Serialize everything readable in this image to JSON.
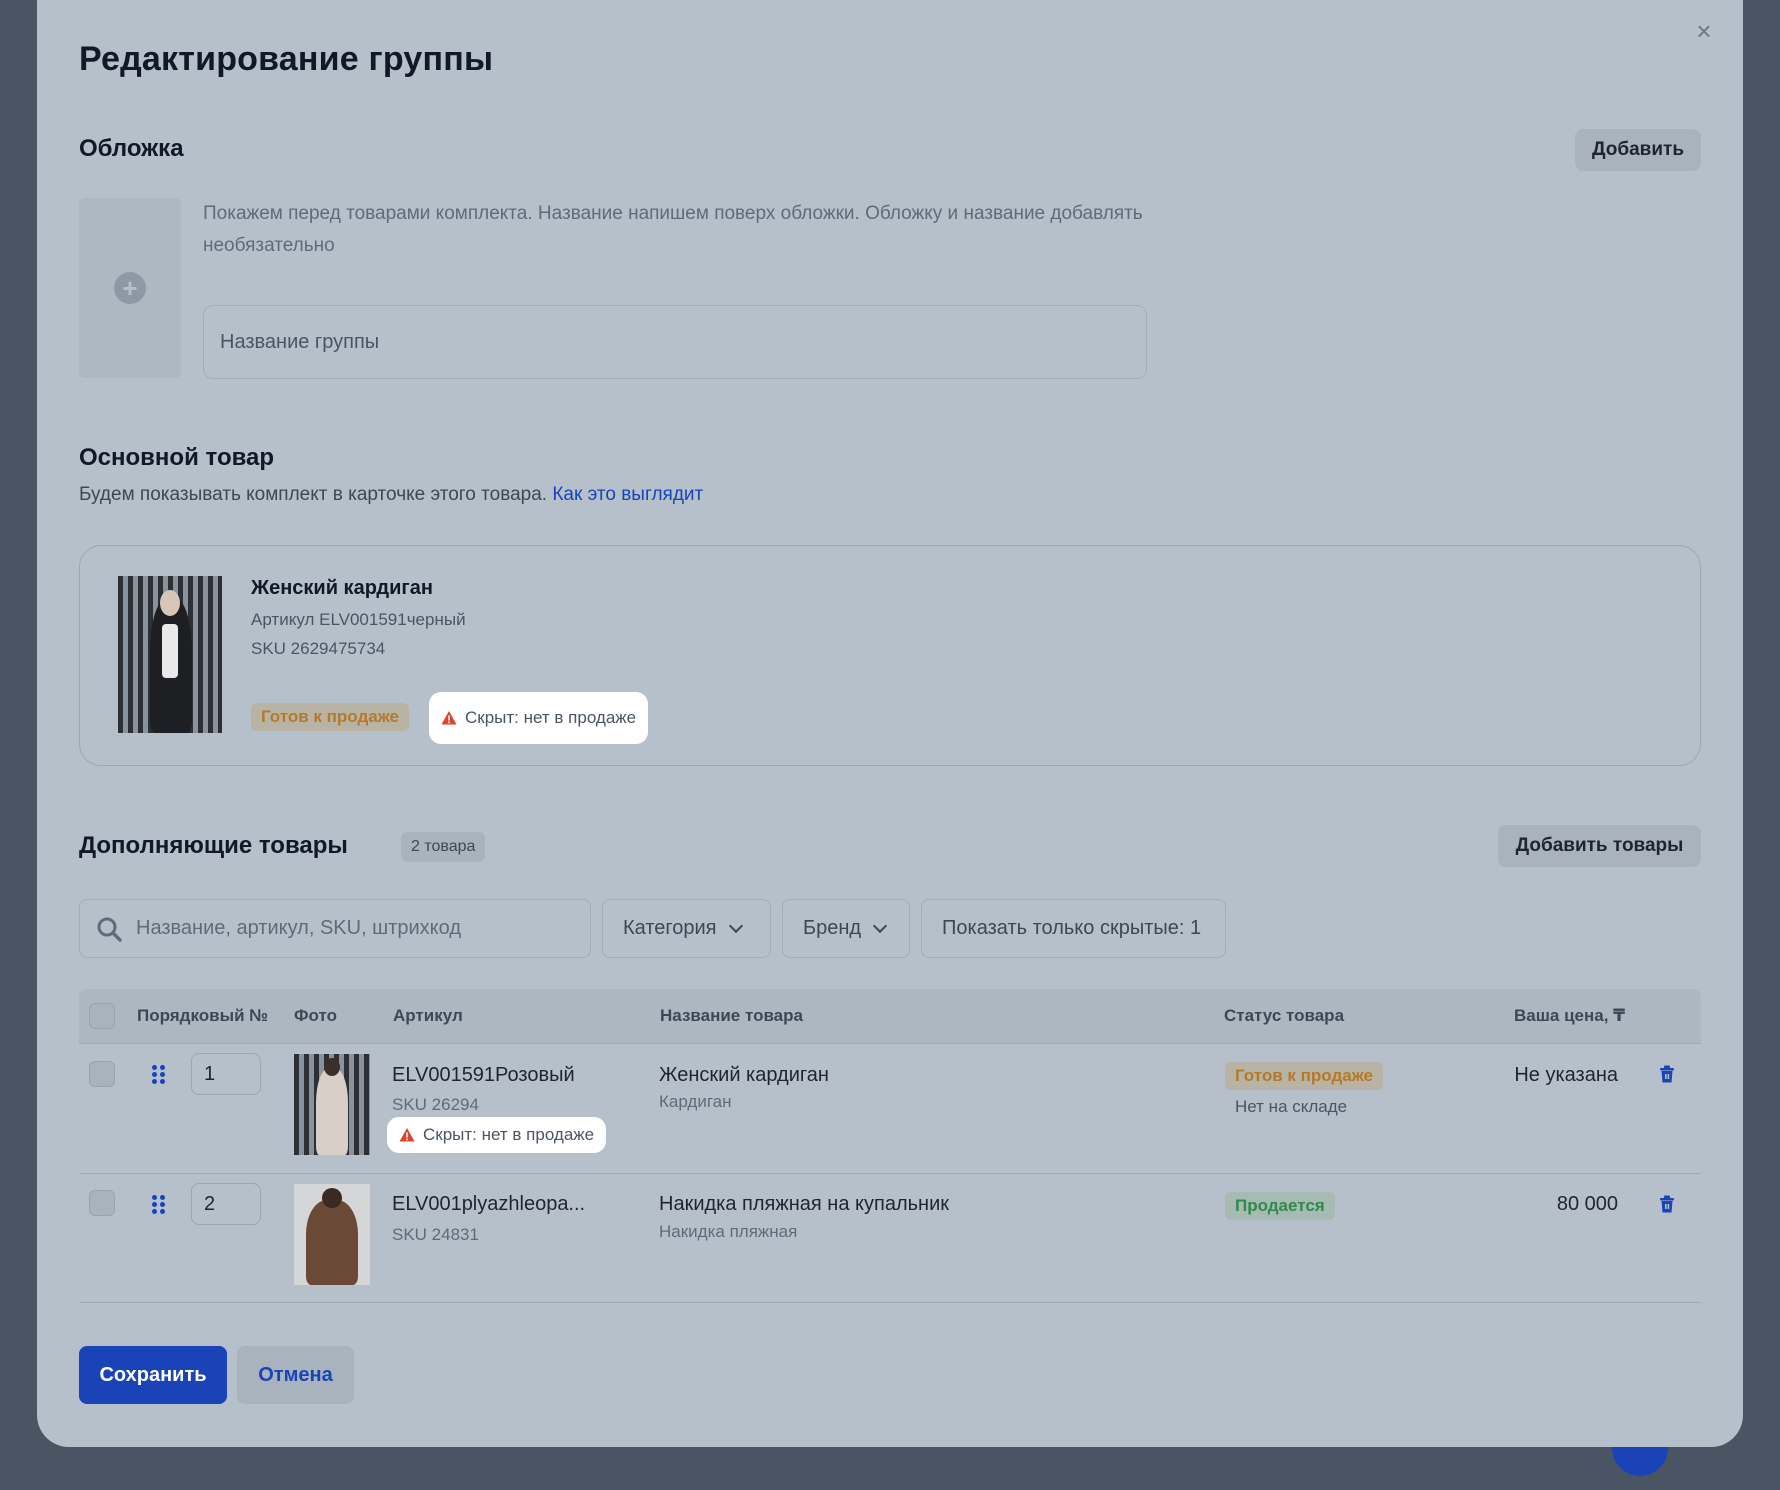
{
  "modal": {
    "title": "Редактирование группы",
    "close_label": "×"
  },
  "cover": {
    "heading": "Обложка",
    "add_button": "Добавить",
    "hint": "Покажем перед товарами комплекта. Название напишем поверх обложки. Обложку и название добавлять необязательно",
    "name_placeholder": "Название группы"
  },
  "main_product": {
    "heading": "Основной товар",
    "description": "Будем показывать комплект в карточке этого товара.",
    "link": "Как это выглядит",
    "name": "Женский кардиган",
    "article": "Артикул ELV001591черный",
    "sku": "SKU 2629475734",
    "status_badge": "Готов к продаже",
    "hidden_label": "Скрыт: нет в продаже"
  },
  "additional": {
    "heading": "Дополняющие товары",
    "count": "2 товара",
    "add_button": "Добавить товары",
    "search_placeholder": "Название, артикул, SKU, штрихкод",
    "filter_category": "Категория",
    "filter_brand": "Бренд",
    "show_hidden": "Показать только скрытые: 1",
    "columns": {
      "order": "Порядковый №",
      "photo": "Фото",
      "article": "Артикул",
      "name": "Название товара",
      "status": "Статус товара",
      "price": "Ваша цена, ₸"
    },
    "rows": [
      {
        "order": "1",
        "article": "ELV001591Розовый",
        "sku": "SKU 26294",
        "hidden_label": "Скрыт: нет в продаже",
        "name": "Женский кардиган",
        "category": "Кардиган",
        "status": "Готов к продаже",
        "status_sub": "Нет на складе",
        "price": "Не указана"
      },
      {
        "order": "2",
        "article": "ELV001plyazhleopa...",
        "sku": "SKU 24831",
        "name": "Накидка пляжная на купальник",
        "category": "Накидка пляжная",
        "status": "Продается",
        "price": "80 000"
      }
    ]
  },
  "footer": {
    "save": "Сохранить",
    "cancel": "Отмена"
  },
  "colors": {
    "accent": "#1a43b8",
    "warning": "#e0432a",
    "ready": "#b37a2a",
    "selling": "#2f8a4c"
  }
}
